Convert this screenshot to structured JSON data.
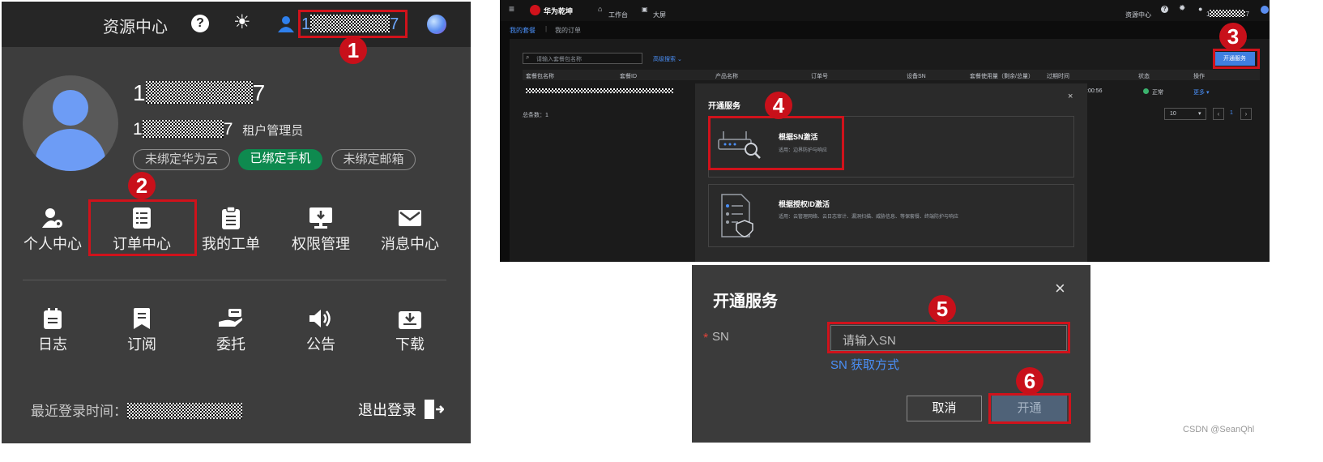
{
  "panel1": {
    "title": "资源中心",
    "username_start": "1",
    "username_end": "7",
    "account_start": "1",
    "account_end": "7",
    "role": "租户管理员",
    "chips": [
      "未绑定华为云",
      "已绑定手机",
      "未绑定邮箱"
    ],
    "row1": [
      "个人中心",
      "订单中心",
      "我的工单",
      "权限管理",
      "消息中心"
    ],
    "row2": [
      "日志",
      "订阅",
      "委托",
      "公告",
      "下载"
    ],
    "last_login_label": "最近登录时间：",
    "logout": "退出登录",
    "colors": {
      "bg": "#3d3d3d",
      "header": "#262626",
      "green": "#0e8a4f",
      "avatar": "#6d9cf5"
    }
  },
  "panel2": {
    "brand": "华为乾坤",
    "nav": [
      "工作台",
      "大屏"
    ],
    "top_right": {
      "resource": "资源中心",
      "user_start": "1",
      "user_end": "7"
    },
    "tabs": [
      "我的套餐",
      "我的订单"
    ],
    "search_placeholder": "请输入套餐包名称",
    "advanced_search": "高级搜索",
    "open_button": "开通服务",
    "columns": [
      "套餐包名称",
      "套餐ID",
      "产品名称",
      "订单号",
      "设备SN",
      "套餐使用量（剩余/总量）",
      "过期时间",
      "状态",
      "操作"
    ],
    "row": {
      "time_tail": ":00:56",
      "status": "正常",
      "more": "更多"
    },
    "total": "总条数：1",
    "page_size": "10",
    "page": "1",
    "dialog": {
      "title": "开通服务",
      "options": [
        {
          "title": "根据SN激活",
          "desc": "适用：边界防护与响应"
        },
        {
          "title": "根据授权ID激活",
          "desc": "适用：云管理网络、云日志审计、漏洞扫描、威胁信息、等保套餐、终端防护与响应"
        }
      ]
    }
  },
  "panel3": {
    "title": "开通服务",
    "required_mark": "*",
    "sn_label": "SN",
    "sn_placeholder": "请输入SN",
    "sn_help": "SN 获取方式",
    "cancel": "取消",
    "confirm": "开通"
  },
  "badges": [
    "1",
    "2",
    "3",
    "4",
    "5",
    "6"
  ],
  "watermark": "CSDN @SeanQhl"
}
